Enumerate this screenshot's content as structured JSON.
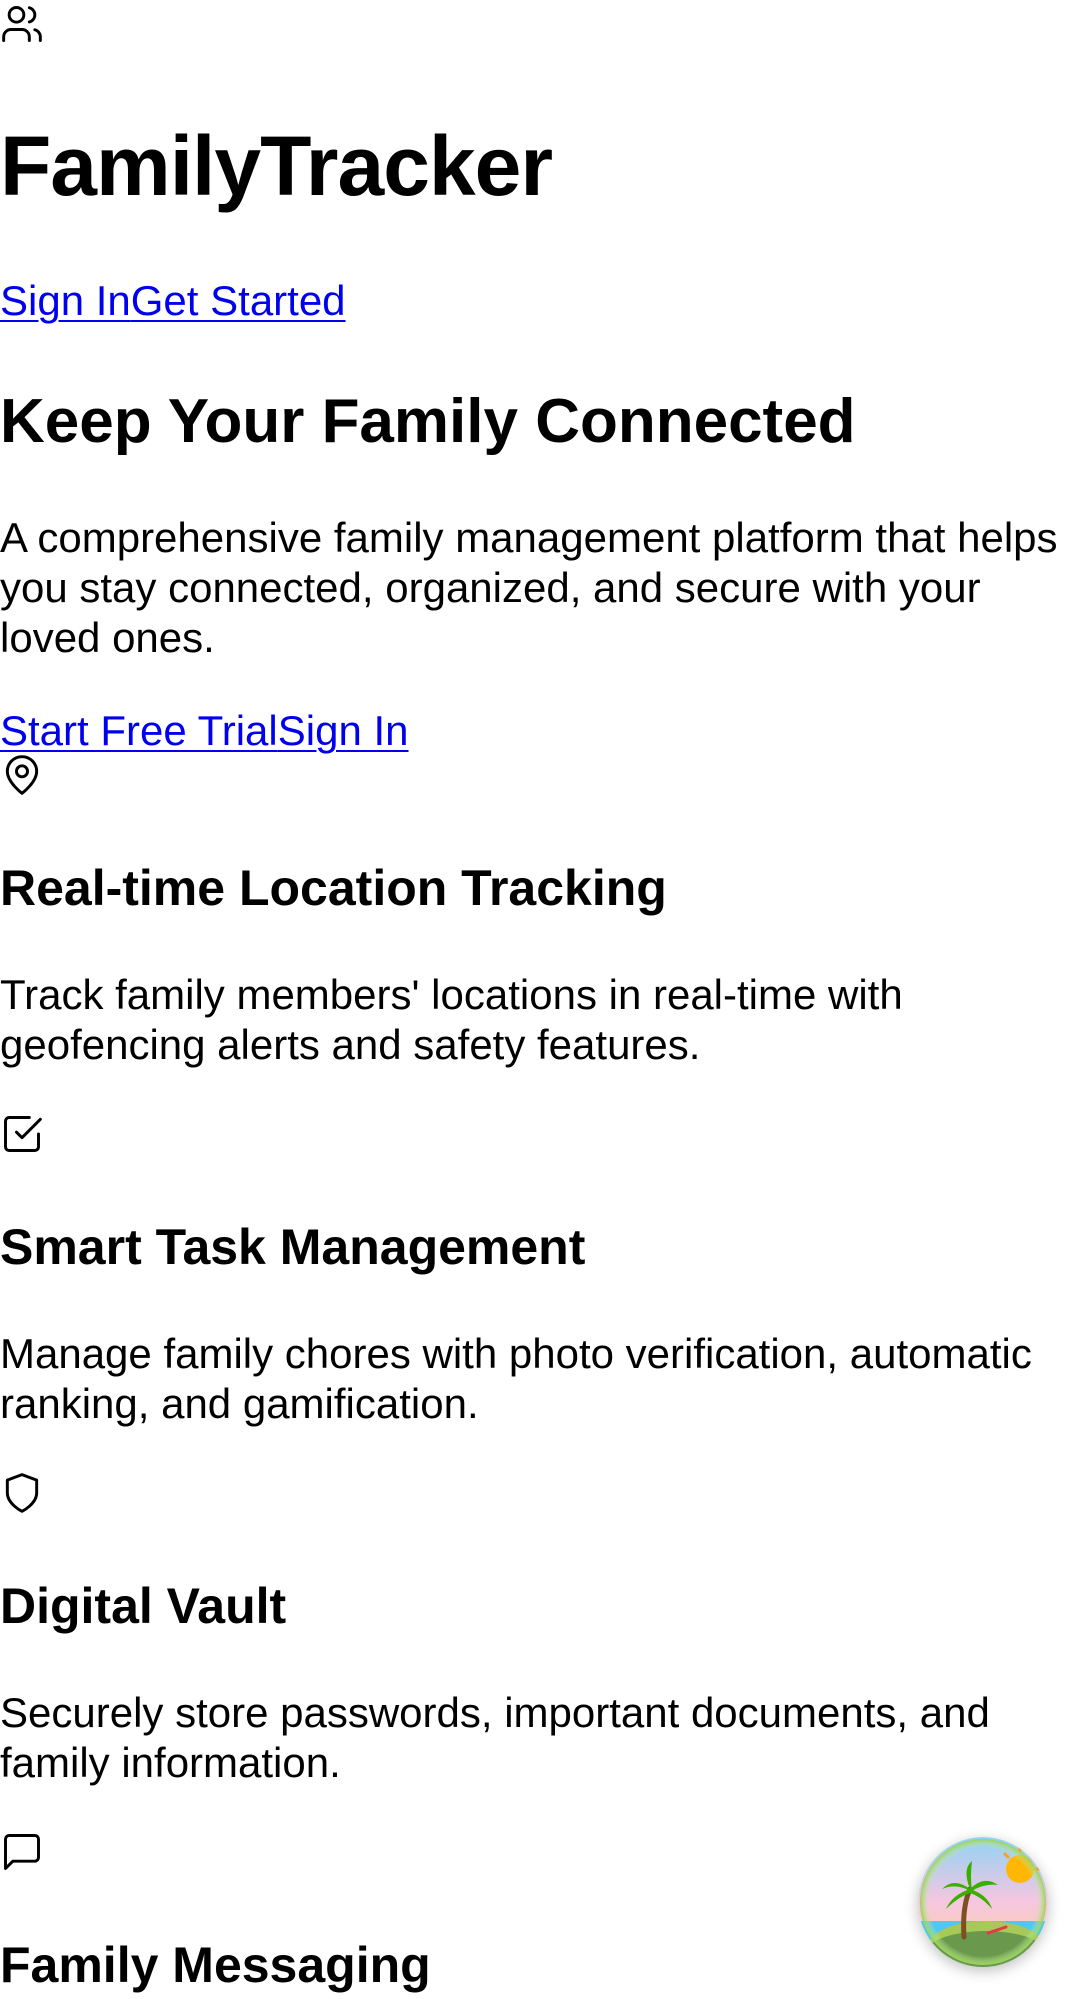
{
  "header": {
    "icon": "users-icon",
    "brand": "FamilyTracker",
    "nav": {
      "sign_in": "Sign In",
      "get_started": "Get Started"
    }
  },
  "hero": {
    "title": "Keep Your Family Connected",
    "description": "A comprehensive family management platform that helps you stay connected, organized, and secure with your loved ones.",
    "cta": {
      "start_trial": "Start Free Trial",
      "sign_in": "Sign In"
    }
  },
  "features": [
    {
      "icon": "map-pin-icon",
      "title": "Real-time Location Tracking",
      "description": "Track family members' locations in real-time with geofencing alerts and safety features."
    },
    {
      "icon": "checkbox-icon",
      "title": "Smart Task Management",
      "description": "Manage family chores with photo verification, automatic ranking, and gamification."
    },
    {
      "icon": "shield-icon",
      "title": "Digital Vault",
      "description": "Securely store passwords, important documents, and family information."
    },
    {
      "icon": "message-square-icon",
      "title": "Family Messaging",
      "description": ""
    }
  ],
  "floating_button": {
    "icon": "island-avatar-icon"
  },
  "colors": {
    "link": "#0000ee",
    "text": "#000000",
    "background": "#ffffff"
  }
}
